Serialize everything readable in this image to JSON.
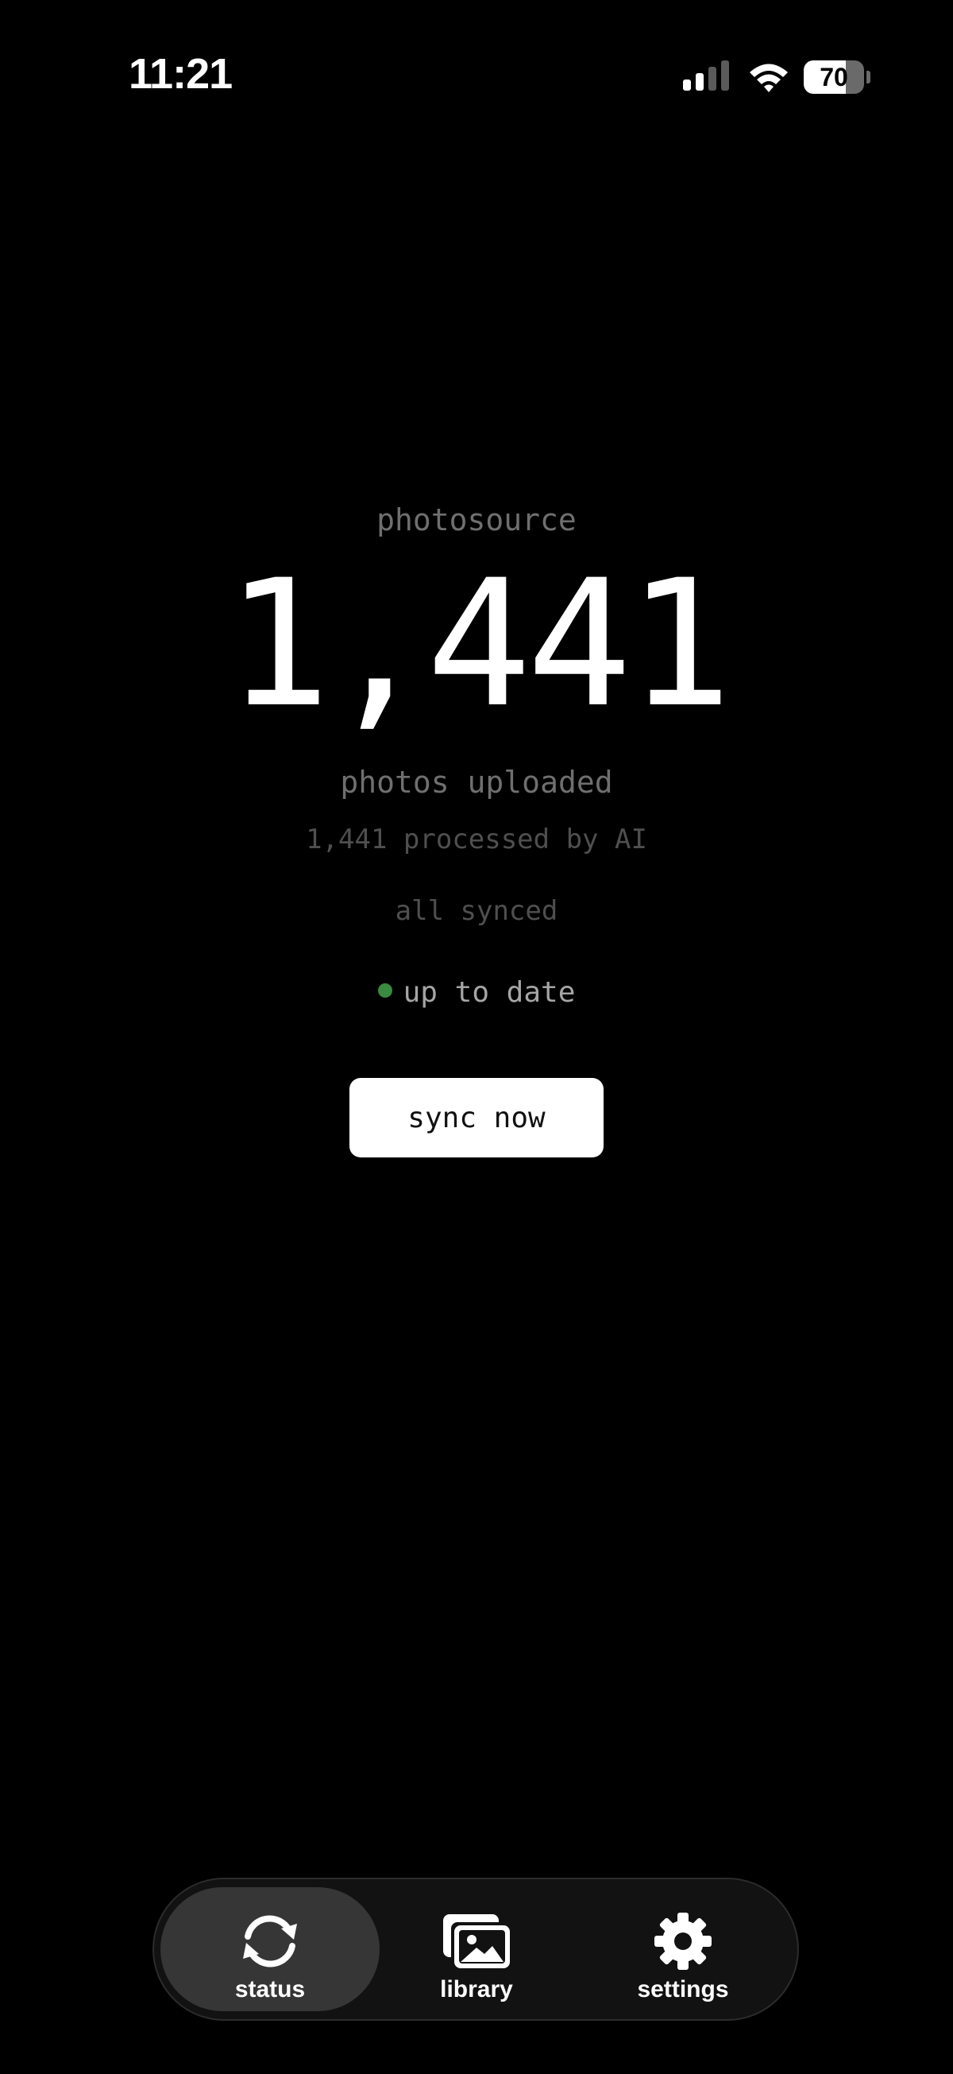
{
  "status_bar": {
    "time": "11:21",
    "battery_level": "70",
    "battery_fraction": 0.7
  },
  "main": {
    "app_title": "photosource",
    "photo_count": "1,441",
    "count_label": "photos uploaded",
    "processed_text": "1,441 processed by AI",
    "synced_text": "all synced",
    "status_text": "up to date",
    "status_color": "#3a8a3f",
    "sync_button_label": "sync now"
  },
  "tab_bar": {
    "tabs": [
      {
        "label": "status",
        "icon": "sync-icon",
        "active": true
      },
      {
        "label": "library",
        "icon": "photo-library-icon",
        "active": false
      },
      {
        "label": "settings",
        "icon": "gear-icon",
        "active": false
      }
    ]
  }
}
